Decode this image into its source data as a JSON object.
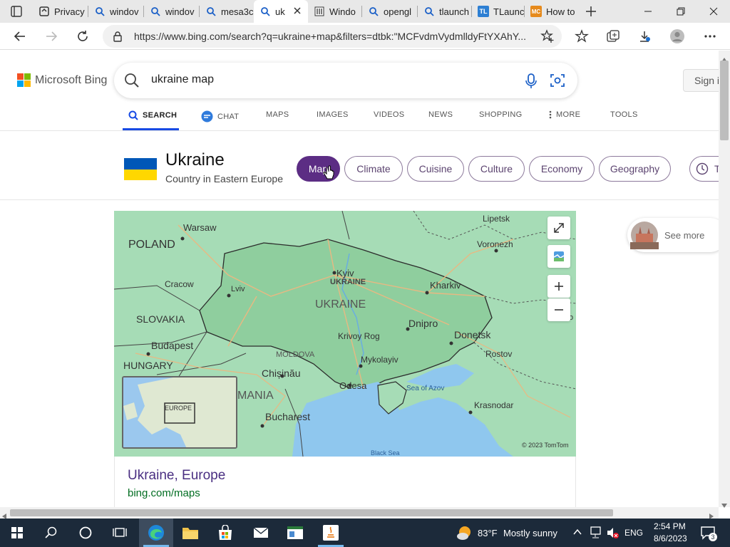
{
  "browser": {
    "tabs": [
      {
        "label": "Privacy",
        "icon": "page-icon"
      },
      {
        "label": "windov",
        "icon": "bing-search-icon"
      },
      {
        "label": "windov",
        "icon": "bing-search-icon"
      },
      {
        "label": "mesa3c",
        "icon": "bing-search-icon"
      },
      {
        "label": "uk",
        "icon": "bing-search-icon",
        "active": true
      },
      {
        "label": "Windo",
        "icon": "ms-learn-icon"
      },
      {
        "label": "opengl",
        "icon": "bing-search-icon"
      },
      {
        "label": "tlaunch",
        "icon": "bing-search-icon"
      },
      {
        "label": "TLaunc",
        "icon": "tlauncher-icon"
      },
      {
        "label": "How to",
        "icon": "mc-icon"
      }
    ],
    "url": "https://www.bing.com/search?q=ukraine+map&filters=dtbk:\"MCFvdmVydmlldyFtYXAhY..."
  },
  "bing": {
    "brand": "Microsoft Bing",
    "query": "ukraine map",
    "sign_in": "Sign i",
    "nav": [
      {
        "label": "SEARCH",
        "active": true
      },
      {
        "label": "CHAT"
      },
      {
        "label": "MAPS"
      },
      {
        "label": "IMAGES"
      },
      {
        "label": "VIDEOS"
      },
      {
        "label": "NEWS"
      },
      {
        "label": "SHOPPING"
      },
      {
        "label": "MORE"
      },
      {
        "label": "TOOLS"
      }
    ]
  },
  "entity": {
    "title": "Ukraine",
    "subtitle": "Country in Eastern Europe",
    "pills": [
      "Map",
      "Climate",
      "Cuisine",
      "Culture",
      "Economy",
      "Geography",
      "T"
    ],
    "flag_colors": [
      "#0057b7",
      "#ffd700"
    ]
  },
  "map": {
    "labels": {
      "lipetsk": "Lipetsk",
      "warsaw": "Warsaw",
      "voronezh": "Voronezh",
      "poland": "POLAND",
      "kyiv": "Kyiv",
      "ukraine": "UKRAINE",
      "cracow": "Cracow",
      "lviv": "Lviv",
      "kharkiv": "Kharkiv",
      "slovakia": "SLOVAKIA",
      "dnipro": "Dnipro",
      "donetsk": "Donetsk",
      "krivoy_rog": "Krivoy Rog",
      "budapest": "Budapest",
      "moldova": "MOLDOVA",
      "mykolayiv": "Mykolayiv",
      "rostov": "Rostov",
      "hungary": "HUNGARY",
      "chisinau": "Chișinău",
      "odesa": "Odesa",
      "sea_of_azov": "Sea of Azov",
      "romania": "MANIA",
      "bucharest": "Bucharest",
      "krasnodar": "Krasnodar",
      "black_sea": "Black Sea",
      "copyright": "© 2023 TomTom",
      "europe": "EUROPE",
      "edge_label": "o"
    }
  },
  "result": {
    "title": "Ukraine, Europe",
    "url": "bing.com/maps"
  },
  "see_more": "See more",
  "taskbar": {
    "weather_temp": "83°F",
    "weather_desc": "Mostly sunny",
    "language": "ENG",
    "time": "2:54 PM",
    "date": "8/6/2023",
    "notification_count": "3"
  }
}
